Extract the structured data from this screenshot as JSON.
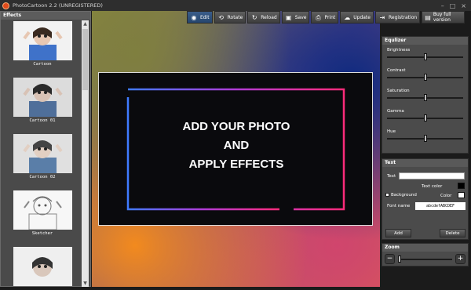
{
  "window": {
    "title": "PhotoCartoon 2.2 (UNREGISTERED)"
  },
  "sidebar": {
    "header": "Effects",
    "items": [
      {
        "label": "Cartoon"
      },
      {
        "label": "Cartoon 01"
      },
      {
        "label": "Cartoon 02"
      },
      {
        "label": "Sketcher"
      },
      {
        "label": ""
      }
    ]
  },
  "toolbar": {
    "buttons": [
      {
        "label": "Edit",
        "icon": "camera-icon"
      },
      {
        "label": "Rotate",
        "icon": "rotate-icon"
      },
      {
        "label": "Reload",
        "icon": "reload-icon"
      },
      {
        "label": "Save",
        "icon": "save-icon"
      },
      {
        "label": "Print",
        "icon": "print-icon"
      },
      {
        "label": "Update",
        "icon": "cloud-download-icon"
      },
      {
        "label": "Registration",
        "icon": "registration-icon"
      },
      {
        "label": "Buy full version",
        "icon": "cart-icon"
      }
    ]
  },
  "canvas": {
    "line1": "ADD YOUR PHOTO",
    "line2": "AND",
    "line3": "APPLY EFFECTS"
  },
  "equalizer": {
    "title": "Equlizer",
    "sliders": [
      {
        "label": "Brightness",
        "value": 0.5
      },
      {
        "label": "Contrast",
        "value": 0.5
      },
      {
        "label": "Saturation",
        "value": 0.5
      },
      {
        "label": "Gamma",
        "value": 0.5
      },
      {
        "label": "Hue",
        "value": 0.5
      }
    ]
  },
  "text_panel": {
    "title": "Text",
    "text_label": "Text",
    "text_value": "",
    "text_color_label": "Text color",
    "text_color": "#000000",
    "background_label": "Background",
    "color_label": "Color",
    "background_color": "#ffffff",
    "font_label": "Font name",
    "font_sample": "abcdefABCDEF",
    "add_label": "Add",
    "delete_label": "Delete"
  },
  "zoom": {
    "title": "Zoom",
    "value": 0.0
  },
  "colors": {
    "accent": "#2f5f96",
    "neon_blue": "#3f7bff",
    "neon_pink": "#ff2b7a"
  }
}
